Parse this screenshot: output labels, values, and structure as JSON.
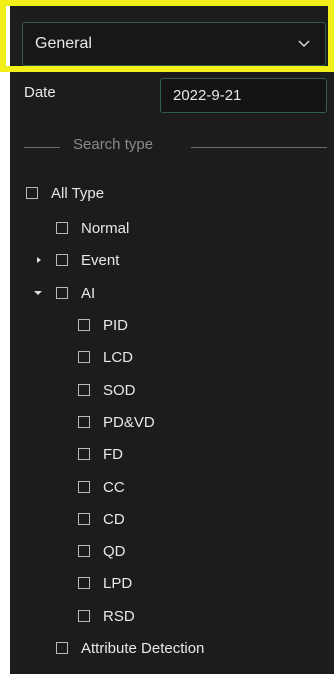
{
  "filter": {
    "mode_selected": "General"
  },
  "date": {
    "label": "Date",
    "value": "2022-9-21"
  },
  "search_type": {
    "title": "Search type",
    "all_type": "All Type",
    "normal": "Normal",
    "event": "Event",
    "ai": "AI",
    "ai_children": [
      "PID",
      "LCD",
      "SOD",
      "PD&VD",
      "FD",
      "CC",
      "CD",
      "QD",
      "LPD",
      "RSD"
    ],
    "attribute_detection": "Attribute Detection"
  },
  "colors": {
    "highlight": "#f2ee1a",
    "panel": "#1c1c1c",
    "input_border": "#2f5f45"
  },
  "icons": {
    "dropdown": "chevron-down-icon",
    "event_toggle": "caret-right-icon",
    "ai_toggle": "caret-down-icon"
  }
}
